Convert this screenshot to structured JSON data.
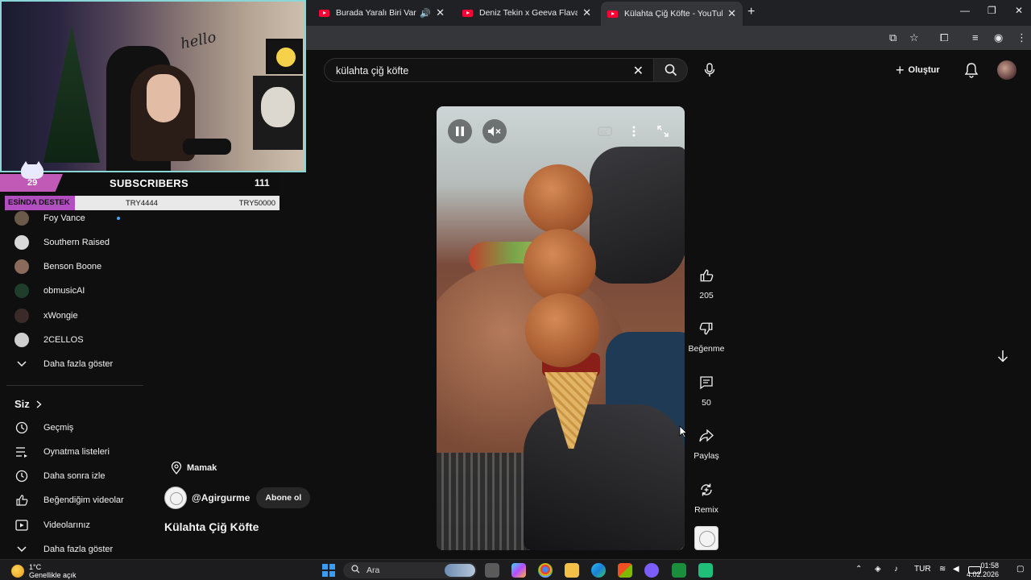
{
  "browser": {
    "tabs": [
      {
        "title": "Burada Yaralı Biri Var - YouT",
        "audio": "🔊",
        "active": false
      },
      {
        "title": "Deniz Tekin x Geeva Flava x Dil",
        "active": false
      },
      {
        "title": "Külahta Çiğ Köfte - YouTube",
        "active": true
      }
    ],
    "new_tab": "+",
    "close_glyph": "✕"
  },
  "stream_overlay": {
    "subscriber_goal": {
      "current": "29",
      "title": "SUBSCRIBERS",
      "target": "111"
    },
    "donation_bar": {
      "label": "ESİNDA DESTEK",
      "mid": "TRY4444",
      "right": "TRY50000"
    },
    "webcam_sign": "hello"
  },
  "youtube": {
    "search": {
      "query": "külahta çiğ köfte"
    },
    "create_label": "Oluştur",
    "sidebar": {
      "subscriptions": [
        {
          "label": "Foy Vance",
          "live": true,
          "color": "#6b5a4a"
        },
        {
          "label": "Southern Raised",
          "live": false,
          "color": "#d8d8d8"
        },
        {
          "label": "Benson Boone",
          "live": false,
          "color": "#8a6a5a"
        },
        {
          "label": "obmusicAI",
          "live": false,
          "color": "#1e3d2a"
        },
        {
          "label": "xWongie",
          "live": false,
          "color": "#3a2a2a"
        },
        {
          "label": "2CELLOS",
          "live": false,
          "color": "#cfcfcf"
        }
      ],
      "show_more_1": "Daha fazla göster",
      "you_section": "Siz",
      "you_items": [
        {
          "label": "Geçmiş",
          "icon": "history-icon"
        },
        {
          "label": "Oynatma listeleri",
          "icon": "playlists-icon"
        },
        {
          "label": "Daha sonra izle",
          "icon": "watch-later-icon"
        },
        {
          "label": "Beğendiğim videolar",
          "icon": "thumbs-up-icon"
        },
        {
          "label": "Videolarınız",
          "icon": "your-videos-icon"
        }
      ],
      "show_more_2": "Daha fazla göster"
    },
    "short": {
      "location": "Mamak",
      "channel": "@Agirgurme",
      "subscribe_label": "Abone ol",
      "title": "Külahta Çiğ Köfte",
      "likes": "205",
      "dislike_label": "Beğenme",
      "comments": "50",
      "share_label": "Paylaş",
      "remix_label": "Remix"
    }
  },
  "taskbar": {
    "weather_temp": "1°C",
    "weather_desc": "Genellikle açık",
    "search_placeholder": "Ara",
    "language": "TUR",
    "time": "01:58",
    "date": "4.02.2026"
  },
  "colors": {
    "youtube_red": "#ff0033",
    "background": "#0f0f0f",
    "overlay_pink": "#c05ab6",
    "webcam_border": "#8ad6d6"
  }
}
